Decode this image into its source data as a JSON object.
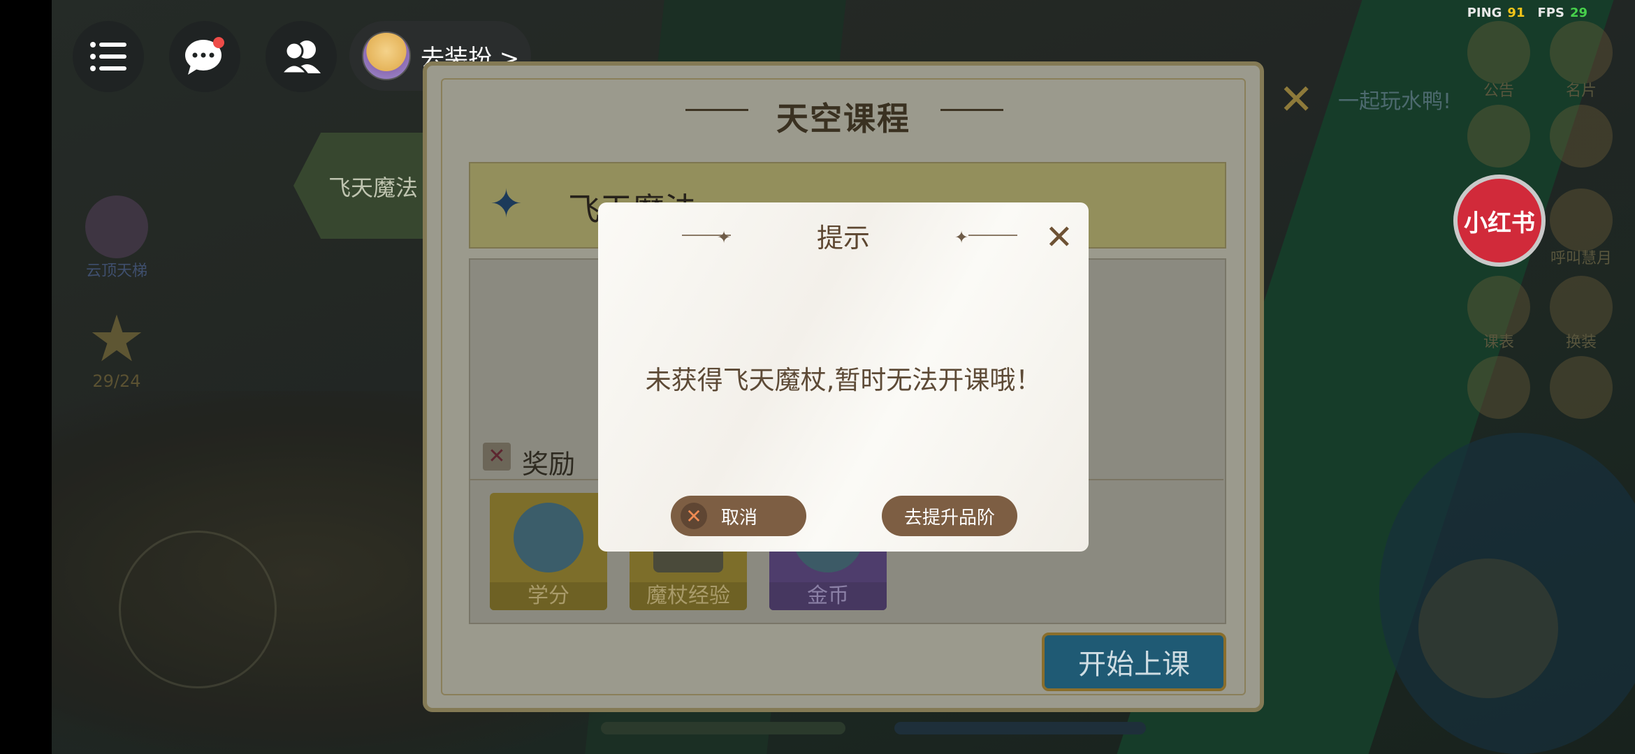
{
  "hud": {
    "dress_label": "去装扮 >",
    "ping_label": "PING",
    "ping_value": "91",
    "fps_label": "FPS",
    "fps_value": "29",
    "notification_dot_color": "#ee4c48"
  },
  "background": {
    "left_label_1": "云顶天梯",
    "left_label_2": "29/24",
    "right_grid": [
      "公告",
      "名片",
      "",
      "",
      "",
      "呼叫慧月",
      "课表",
      "换装",
      "",
      ""
    ],
    "xiaohongshu": "小红书",
    "close_hint": "一起玩水鸭!"
  },
  "panel": {
    "title": "天空课程",
    "side_tab": "飞天魔法",
    "header_text": "飞天魔法",
    "reward_label": "奖励",
    "rewards": [
      {
        "label": "学分",
        "icon": "credit-icon"
      },
      {
        "label": "魔杖经验",
        "icon": "wand-exp-icon"
      },
      {
        "label": "金币",
        "icon": "coin-icon"
      }
    ],
    "start_button": "开始上课"
  },
  "dialog": {
    "title": "提示",
    "message": "未获得飞天魔杖,暂时无法开课哦！",
    "cancel_label": "取消",
    "upgrade_label": "去提升品阶"
  },
  "bars": {
    "health_fraction": 0.0,
    "mana_fraction": 0.0
  }
}
